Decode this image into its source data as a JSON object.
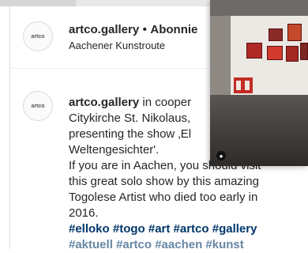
{
  "post": {
    "header": {
      "avatar_text": "artco",
      "username": "artco.gallery",
      "separator": "•",
      "follow_label": "Abonnie",
      "location": "Aachener Kunstroute"
    },
    "caption": {
      "avatar_text": "artco",
      "username": "artco.gallery",
      "line1_rest": " in cooper",
      "line2": "Citykirche St. Nikolaus,",
      "line3": "presenting the show ‚El",
      "line4": "Weltengesichter'.",
      "line5": "If you are in Aachen, you should visit",
      "line6": "this great solo show by this amazing",
      "line7": "Togolese Artist who died too early in",
      "line8": "2016.",
      "hashtags": "#elloko #togo #art #artco #gallery",
      "hashtags_cut": "#aktuell #artco #aachen #kunst"
    }
  },
  "video_overlay": {
    "icon": "camera-icon",
    "icon_glyph": "●"
  }
}
